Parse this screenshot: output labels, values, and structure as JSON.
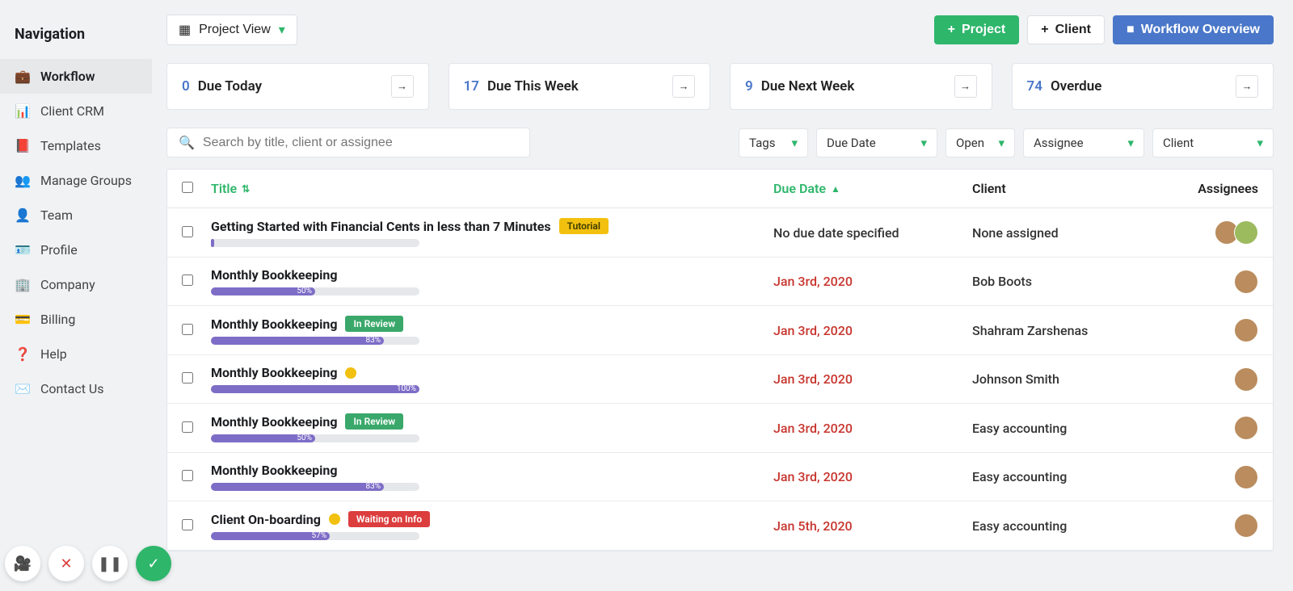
{
  "sidebar": {
    "title": "Navigation",
    "items": [
      {
        "label": "Workflow",
        "icon": "briefcase-icon",
        "glyph": "💼",
        "active": true
      },
      {
        "label": "Client CRM",
        "icon": "dashboard-icon",
        "glyph": "📊",
        "active": false
      },
      {
        "label": "Templates",
        "icon": "book-icon",
        "glyph": "📕",
        "active": false
      },
      {
        "label": "Manage Groups",
        "icon": "users-icon",
        "glyph": "👥",
        "active": false
      },
      {
        "label": "Team",
        "icon": "user-card-icon",
        "glyph": "👤",
        "active": false
      },
      {
        "label": "Profile",
        "icon": "id-card-icon",
        "glyph": "🪪",
        "active": false
      },
      {
        "label": "Company",
        "icon": "building-icon",
        "glyph": "🏢",
        "active": false
      },
      {
        "label": "Billing",
        "icon": "credit-card-icon",
        "glyph": "💳",
        "active": false
      },
      {
        "label": "Help",
        "icon": "help-icon",
        "glyph": "❓",
        "active": false
      },
      {
        "label": "Contact Us",
        "icon": "mail-icon",
        "glyph": "✉️",
        "active": false
      }
    ]
  },
  "topbar": {
    "view_btn": "Project View",
    "btn_project": "Project",
    "btn_client": "Client",
    "btn_workflow": "Workflow Overview"
  },
  "summary": [
    {
      "count": "0",
      "label": "Due Today"
    },
    {
      "count": "17",
      "label": "Due This Week"
    },
    {
      "count": "9",
      "label": "Due Next Week"
    },
    {
      "count": "74",
      "label": "Overdue"
    }
  ],
  "filters": {
    "search_placeholder": "Search by title, client or assignee",
    "tags": "Tags",
    "due_date": "Due Date",
    "status": "Open",
    "assignee": "Assignee",
    "client": "Client"
  },
  "columns": {
    "title": "Title",
    "due_date": "Due Date",
    "client": "Client",
    "assignees": "Assignees"
  },
  "rows": [
    {
      "title": "Getting Started with Financial Cents in less than 7 Minutes",
      "badge": "Tutorial",
      "badge_class": "badge-tutorial",
      "alert": false,
      "progress": 0,
      "progress_label": "",
      "due": "No due date specified",
      "due_class": "due-plain",
      "client": "None assigned",
      "avatars": 2
    },
    {
      "title": "Monthly Bookkeeping",
      "badge": null,
      "alert": false,
      "progress": 50,
      "progress_label": "50%",
      "due": "Jan 3rd, 2020",
      "due_class": "due-red",
      "client": "Bob Boots",
      "avatars": 1
    },
    {
      "title": "Monthly Bookkeeping",
      "badge": "In Review",
      "badge_class": "badge-inreview",
      "alert": false,
      "progress": 83,
      "progress_label": "83%",
      "due": "Jan 3rd, 2020",
      "due_class": "due-red",
      "client": "Shahram Zarshenas",
      "avatars": 1
    },
    {
      "title": "Monthly Bookkeeping",
      "badge": null,
      "alert": true,
      "progress": 100,
      "progress_label": "100%",
      "due": "Jan 3rd, 2020",
      "due_class": "due-red",
      "client": "Johnson Smith",
      "avatars": 1
    },
    {
      "title": "Monthly Bookkeeping",
      "badge": "In Review",
      "badge_class": "badge-inreview",
      "alert": false,
      "progress": 50,
      "progress_label": "50%",
      "due": "Jan 3rd, 2020",
      "due_class": "due-red",
      "client": "Easy accounting",
      "avatars": 1
    },
    {
      "title": "Monthly Bookkeeping",
      "badge": null,
      "alert": false,
      "progress": 83,
      "progress_label": "83%",
      "due": "Jan 3rd, 2020",
      "due_class": "due-red",
      "client": "Easy accounting",
      "avatars": 1
    },
    {
      "title": "Client On-boarding",
      "badge": "Waiting on Info",
      "badge_class": "badge-wait",
      "alert": true,
      "progress": 57,
      "progress_label": "57%",
      "due": "Jan 5th, 2020",
      "due_class": "due-red",
      "client": "Easy accounting",
      "avatars": 1
    }
  ]
}
